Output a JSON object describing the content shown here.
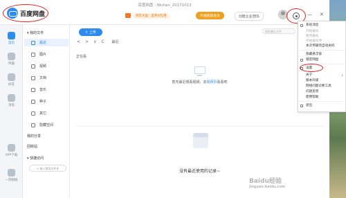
{
  "window_title": "百度网盘 - Wuhan_20171013",
  "brand": {
    "name": "百度网盘"
  },
  "header": {
    "vip_text": "开年大促：首月4元/月",
    "open_vip_label": "开通超级会员",
    "create_team_label": "创建企业/团队",
    "minimize": "—",
    "close": "✕"
  },
  "rail": [
    {
      "label": "首页"
    },
    {
      "label": "传输"
    },
    {
      "label": "好友"
    },
    {
      "label": "消息"
    },
    {
      "label": "APP下载"
    },
    {
      "label": "一刻相册"
    }
  ],
  "sidebar": {
    "my_files": "我的文件",
    "items": [
      {
        "label": "最近"
      },
      {
        "label": "图片"
      },
      {
        "label": "视频"
      },
      {
        "label": "文档"
      },
      {
        "label": "音乐"
      },
      {
        "label": "种子"
      },
      {
        "label": "其它"
      },
      {
        "label": "隐藏空间"
      }
    ],
    "my_share": "我的分享",
    "recycle": "回收站",
    "quick_access": "快捷访问",
    "quick_hint": "拖入常用文件夹"
  },
  "main": {
    "upload_label": "上传",
    "nav_back": "<",
    "nav_forward": ">",
    "nav_down": "∨",
    "nav_refresh": "C",
    "breadcrumb": "最近",
    "search_placeholder": "搜索最近文件",
    "section_title": "正在看",
    "empty_video_msg_a": "暂无最近观看视频，去",
    "empty_video_msg_link": "视频页",
    "empty_video_msg_b": "看看吧",
    "empty_recent_msg": "没有最近使用的记录~"
  },
  "menu": {
    "items": [
      {
        "label": "系统消息",
        "disabled": false
      },
      {
        "label": "开始备份",
        "disabled": true
      },
      {
        "label": "暂停备份",
        "disabled": true
      },
      {
        "label": "开始备份项",
        "disabled": true
      },
      {
        "label": "本次传输完自动关机",
        "disabled": false
      },
      {
        "label": "隐藏悬浮窗",
        "disabled": false
      },
      {
        "label": "锁定网盘",
        "disabled": false
      },
      {
        "label": "设置",
        "disabled": false
      },
      {
        "label": "关于",
        "disabled": false,
        "arrow": "▸"
      },
      {
        "label": "版本升级",
        "disabled": false
      },
      {
        "label": "网络问题诊断工具",
        "disabled": false
      },
      {
        "label": "问题反馈",
        "disabled": false
      },
      {
        "label": "使用帮助",
        "disabled": false
      },
      {
        "label": "退出",
        "disabled": false
      }
    ]
  },
  "watermark": {
    "line1": "Baidu经验",
    "line2": "jingyan.baidu.com"
  },
  "colors": {
    "accent": "#2d8cf0",
    "highlight_ring": "#e02020",
    "vip_orange": "#f0a020"
  }
}
